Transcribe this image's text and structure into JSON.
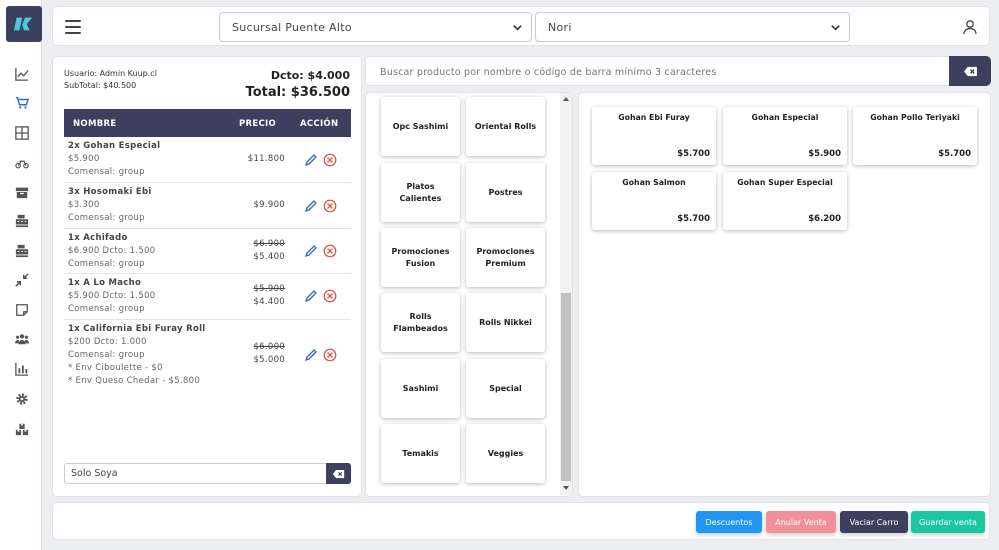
{
  "topbar": {
    "branch": "Sucursal Puente Alto",
    "store": "Nori"
  },
  "cart": {
    "user": "Usuario: Admin Kuup.cl",
    "subtotal": "SubTotal: $40.500",
    "discount": "Dcto: $4.000",
    "total": "Total: $36.500",
    "columns": {
      "name": "NOMBRE",
      "price": "PRECIO",
      "action": "ACCIÓN"
    },
    "items": [
      {
        "name": "2x Gohan Especial",
        "lines": [
          "$5.900",
          "Comensal: group"
        ],
        "price": "$11.800"
      },
      {
        "name": "3x Hosomaki Ebi",
        "lines": [
          "$3.300",
          "Comensal: group"
        ],
        "price": "$9.900"
      },
      {
        "name": "1x Achifado",
        "lines": [
          "$6.900 Dcto: 1.500",
          "Comensal: group"
        ],
        "old_price": "$6.900",
        "price": "$5.400"
      },
      {
        "name": "1x A Lo Macho",
        "lines": [
          "$5.900 Dcto: 1.500",
          "Comensal: group"
        ],
        "old_price": "$5.900",
        "price": "$4.400"
      },
      {
        "name": "1x California Ebi Furay Roll",
        "lines": [
          "$200 Dcto: 1.000",
          "Comensal: group",
          "* Env Ciboulette - $0",
          "* Env Queso Chedar - $5.800"
        ],
        "old_price": "$6.000",
        "price": "$5.000"
      }
    ],
    "note": "Solo Soya"
  },
  "search": {
    "placeholder": "Buscar producto por nombre o código de barra mínimo 3 caracteres"
  },
  "categories": [
    "Opc Sashimi",
    "Oriental Rolls",
    "Platos Calientes",
    "Postres",
    "Promociones Fusion",
    "Promociones Premium",
    "Rolls Flambeados",
    "Rolls Nikkei",
    "Sashimi",
    "Special",
    "Temakis",
    "Veggies"
  ],
  "products": [
    {
      "name": "Gohan Ebi Furay",
      "price": "$5.700"
    },
    {
      "name": "Gohan Especial",
      "price": "$5.900"
    },
    {
      "name": "Gohan Pollo Teriyaki",
      "price": "$5.700"
    },
    {
      "name": "Gohan Salmon",
      "price": "$5.700"
    },
    {
      "name": "Gohan Super Especial",
      "price": "$6.200"
    }
  ],
  "footer": {
    "discounts": "Descuentos",
    "cancel": "Anular Venta",
    "empty": "Vaciar Carro",
    "save": "Guardar venta"
  },
  "colors": {
    "primary": "#3c3f5e",
    "accent": "#3366cc",
    "danger": "#e74a3b",
    "discounts": "#2196f3",
    "cancel": "#f0909a",
    "empty": "#3c3f5e",
    "save": "#1cc7a0"
  }
}
